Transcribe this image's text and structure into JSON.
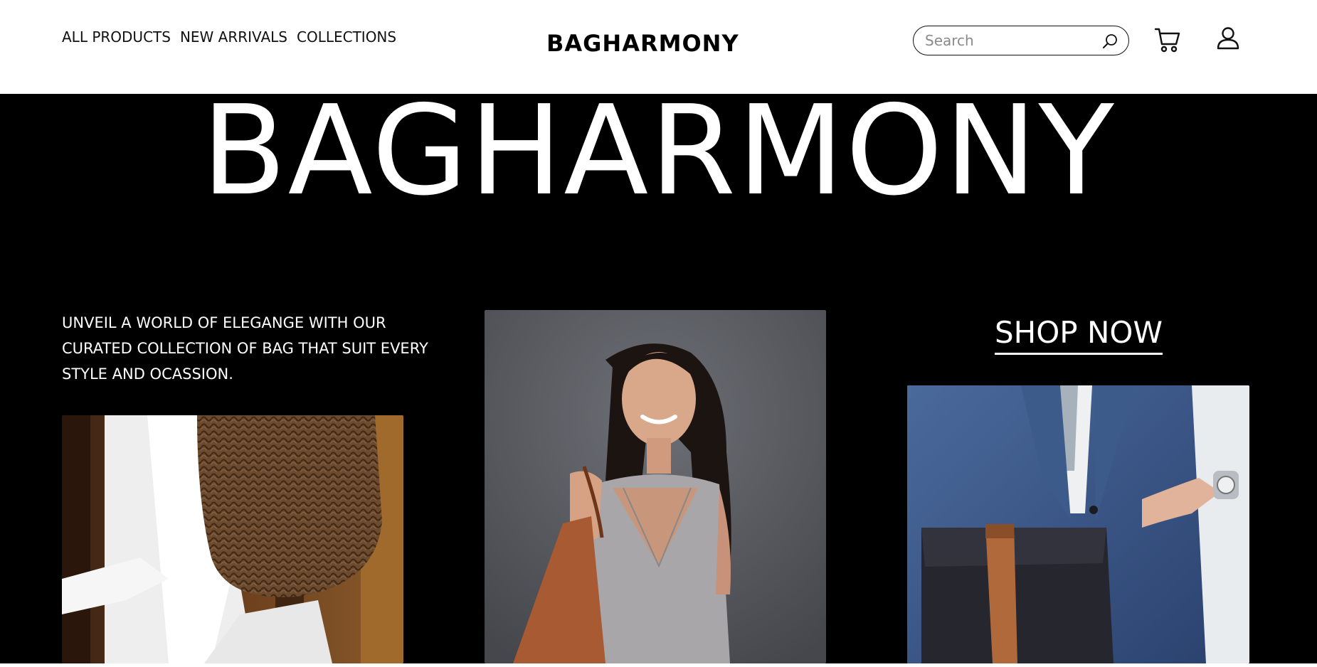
{
  "header": {
    "nav": [
      {
        "label": "ALL PRODUCTS"
      },
      {
        "label": "NEW ARRIVALS"
      },
      {
        "label": "COLLECTIONS"
      }
    ],
    "logo": "BAGHARMONY",
    "search": {
      "placeholder": "Search",
      "value": ""
    },
    "icons": [
      "search-icon",
      "cart-icon",
      "user-icon"
    ]
  },
  "hero": {
    "title": "BAGHARMONY",
    "tagline": "UNVEIL A WORLD OF ELEGANGE WITH OUR CURATED COLLECTION OF BAG THAT SUIT EVERY STYLE AND OCASSION.",
    "cta_label": "SHOP NOW"
  },
  "colors": {
    "hero_background": "#000000",
    "header_background": "#ffffff",
    "text_on_dark": "#ffffff",
    "text_on_light": "#111111"
  }
}
